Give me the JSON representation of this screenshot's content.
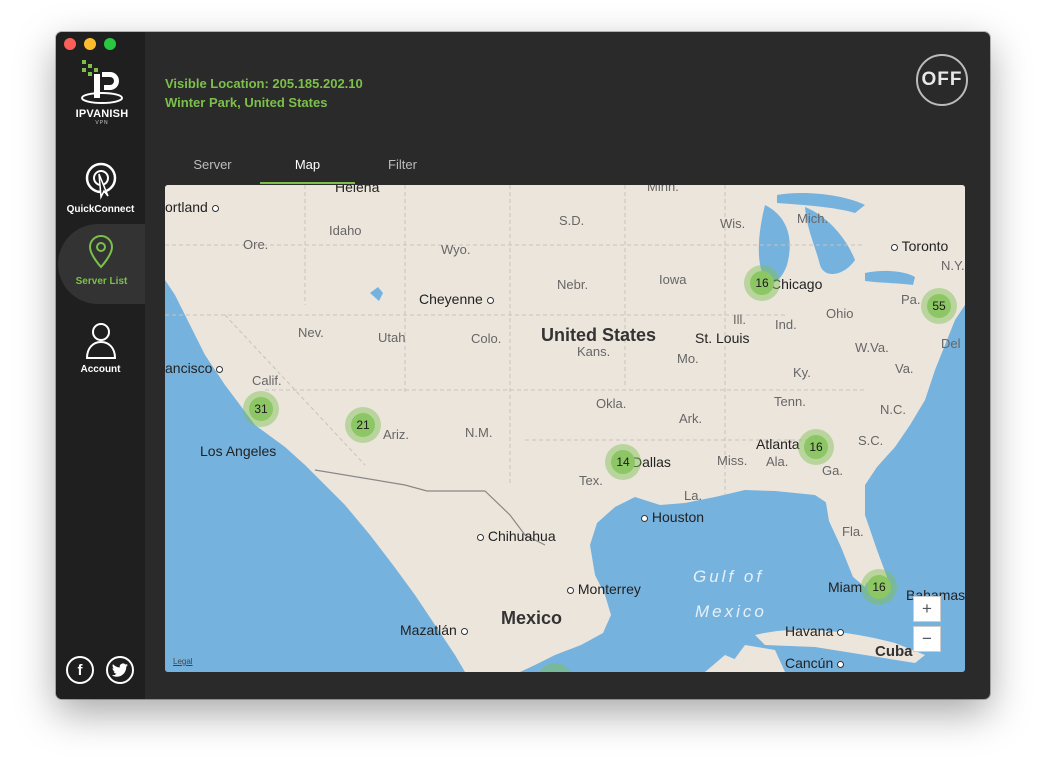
{
  "app": {
    "logo_text": "IPVANISH",
    "logo_sub": "VPN",
    "colors": {
      "accent": "#7cc04b",
      "sidebar": "#1f1f1f",
      "window": "#2a2a2a",
      "water": "#76b2de",
      "land": "#ece5dc"
    }
  },
  "sidebar": {
    "items": [
      {
        "label": "QuickConnect",
        "icon": "quickconnect-icon"
      },
      {
        "label": "Server List",
        "icon": "location-pin-icon"
      },
      {
        "label": "Account",
        "icon": "account-icon"
      }
    ],
    "social": {
      "facebook": "f",
      "twitter": "t"
    }
  },
  "header": {
    "visible_location": "Visible Location: 205.185.202.10",
    "city": "Winter Park, United States",
    "toggle": "OFF"
  },
  "tabs": [
    {
      "label": "Server"
    },
    {
      "label": "Map"
    },
    {
      "label": "Filter"
    }
  ],
  "map": {
    "country_labels": {
      "us": "United States",
      "mx": "Mexico",
      "gulf1": "Gulf of",
      "gulf2": "Mexico"
    },
    "cities": {
      "portland": "ortland",
      "helena": "Helena",
      "minn": "Minn.",
      "toronto": "Toronto",
      "chicago": "Chicago",
      "cheyenne": "Cheyenne",
      "stlouis": "St. Louis",
      "sanfrancisco": "ancisco",
      "losangeles": "Los Angeles",
      "atlanta": "Atlanta",
      "dallas": "Dallas",
      "houston": "Houston",
      "chihuahua": "Chihuahua",
      "monterrey": "Monterrey",
      "mazatlan": "Mazatlán",
      "miami": "Miam",
      "havana": "Havana",
      "cuba": "Cuba",
      "cancun": "Cancún",
      "bahamas": "Bahamas"
    },
    "states": {
      "idaho": "Idaho",
      "ore": "Ore.",
      "wyo": "Wyo.",
      "sd": "S.D.",
      "wis": "Wis.",
      "mich": "Mich.",
      "ny": "N.Y.",
      "nebr": "Nebr.",
      "iowa": "Iowa",
      "pa": "Pa.",
      "nev": "Nev.",
      "utah": "Utah",
      "colo": "Colo.",
      "ill": "Ill.",
      "ind": "Ind.",
      "ohio": "Ohio",
      "kans": "Kans.",
      "mo": "Mo.",
      "wva": "W.Va.",
      "del": "Del",
      "calif": "Calif.",
      "ky": "Ky.",
      "va": "Va.",
      "okla": "Okla.",
      "tenn": "Tenn.",
      "nc": "N.C.",
      "ariz": "Ariz.",
      "nm": "N.M.",
      "ark": "Ark.",
      "sc": "S.C.",
      "miss": "Miss.",
      "ala": "Ala.",
      "ga": "Ga.",
      "tex": "Tex.",
      "la": "La.",
      "fla": "Fla."
    },
    "clusters": {
      "california": "31",
      "arizona": "21",
      "chicago": "16",
      "east": "55",
      "atlanta": "16",
      "dallas": "14",
      "miami": "16"
    },
    "zoom_in": "+",
    "zoom_out": "−",
    "legal": "Legal"
  }
}
